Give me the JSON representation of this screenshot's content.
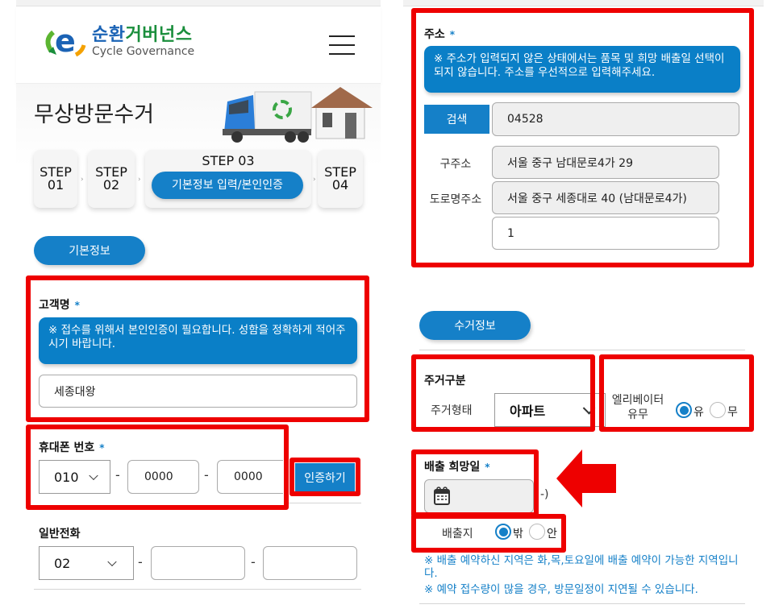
{
  "left": {
    "logo": {
      "ko_part1": "순환",
      "ko_part2": "거버넌스",
      "en": "Cycle Governance"
    },
    "menu_icon": "hamburger-menu-icon",
    "page_title": "무상방문수거",
    "steps": [
      {
        "label_line1": "STEP",
        "label_line2": "01"
      },
      {
        "label_line1": "STEP",
        "label_line2": "02"
      },
      {
        "title": "STEP 03",
        "label": "기본정보 입력/본인인증",
        "active": true
      },
      {
        "label_line1": "STEP",
        "label_line2": "04"
      }
    ],
    "section_basic": "기본정보",
    "customer_name": {
      "label": "고객명",
      "required_mark": "*",
      "notice": "※ 접수를 위해서 본인인증이 필요합니다. 성함을 정확하게 적어주시기 바랍니다.",
      "value": "세종대왕"
    },
    "mobile": {
      "label": "휴대폰 번호",
      "required_mark": "*",
      "prefix": "010",
      "middle": "0000",
      "last": "0000",
      "separator": "-",
      "verify_button": "인증하기"
    },
    "landline": {
      "label": "일반전화",
      "prefix": "02",
      "middle": "",
      "last": "",
      "separator": "-"
    }
  },
  "right": {
    "address": {
      "label": "주소",
      "required_mark": "*",
      "notice": "※ 주소가 입력되지 않은 상태에서는 품목 및 희망 배출일 선택이 되지 않습니다. 주소를 우선적으로 입력해주세요.",
      "search_button": "검색",
      "postcode": "04528",
      "old_label": "구주소",
      "old_value": "서울 중구 남대문로4가 29",
      "road_label": "도로명주소",
      "road_value": "서울 중구 세종대로 40 (남대문로4가)",
      "detail_value": "1"
    },
    "section_pickup": "수거정보",
    "residence": {
      "label": "주거구분",
      "type_label": "주거형태",
      "type_value": "아파트"
    },
    "elevator": {
      "label_line1": "엘리베이터",
      "label_line2": "유무",
      "options": [
        "유",
        "무"
      ],
      "selected": "유"
    },
    "disposal_date": {
      "label": "배출 희망일",
      "required_mark": "*",
      "value": "",
      "suffix": "-)"
    },
    "disposal_place": {
      "label": "배출지",
      "options": [
        "밖",
        "안"
      ],
      "selected": "밖"
    },
    "info": [
      "※ 배출 예약하신 지역은 화,목,토요일에 배출 예약이 가능한 지역입니다.",
      "※ 예약 접수량이 많을 경우, 방문일정이 지연될 수 있습니다."
    ]
  },
  "colors": {
    "brand_blue": "#1580c8",
    "highlight_red": "#ee0000",
    "logo_green": "#1a8e3c"
  }
}
